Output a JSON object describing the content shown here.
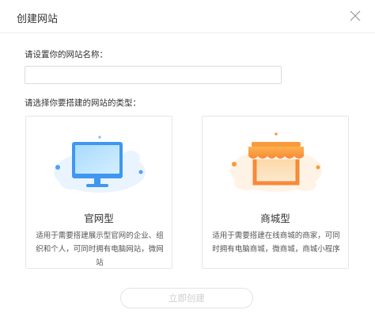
{
  "dialog": {
    "title": "创建网站"
  },
  "form": {
    "name_label": "请设置你的网站名称：",
    "name_value": "",
    "type_label": "请选择你要搭建的网站的类型："
  },
  "cards": [
    {
      "title": "官网型",
      "description": "适用于需要搭建展示型官网的企业、组织和个人，可同时拥有电脑网站，微网站",
      "icon": "monitor-icon"
    },
    {
      "title": "商城型",
      "description": "适用于需要搭建在线商城的商家，可同时拥有电脑商城，微商城，商城小程序",
      "icon": "storefront-icon"
    }
  ],
  "actions": {
    "create_label": "立即创建"
  },
  "colors": {
    "monitor": "#4ea3f5",
    "store": "#f99a3d",
    "disabled_text": "#cfcfcf"
  }
}
